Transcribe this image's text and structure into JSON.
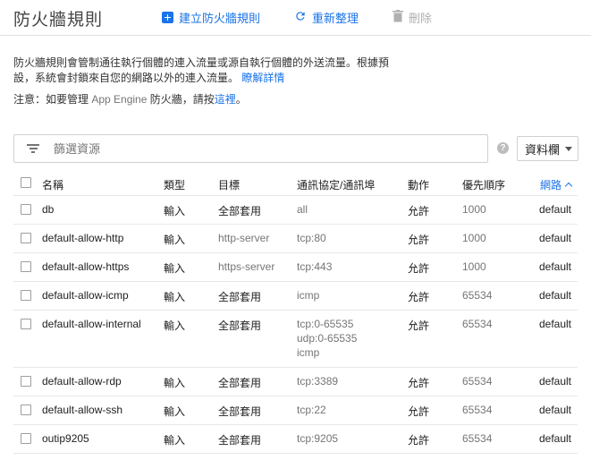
{
  "header": {
    "title": "防火牆規則",
    "create_label": "建立防火牆規則",
    "refresh_label": "重新整理",
    "delete_label": "刪除"
  },
  "description": {
    "line1": "防火牆規則會管制通往執行個體的連入流量或源自執行個體的外送流量。根據預",
    "line2": "設，系統會封鎖來自您的網路以外的連入流量。",
    "learn_more": "瞭解詳情"
  },
  "note": {
    "prefix": "注意：如要管理 ",
    "app_engine": "App Engine",
    "middle": " 防火牆，請按",
    "link": "這裡",
    "suffix": "。"
  },
  "filter": {
    "placeholder": "篩選資源"
  },
  "columns_button": "資料欄",
  "table": {
    "headers": {
      "name": "名稱",
      "type": "類型",
      "target": "目標",
      "protocol": "通訊協定/通訊埠",
      "action": "動作",
      "priority": "優先順序",
      "network": "網路"
    },
    "rows": [
      {
        "name": "db",
        "type": "輸入",
        "target": "全部套用",
        "protocols": [
          "all"
        ],
        "action": "允許",
        "priority": "1000",
        "network": "default"
      },
      {
        "name": "default-allow-http",
        "type": "輸入",
        "target": "http-server",
        "protocols": [
          "tcp:80"
        ],
        "action": "允許",
        "priority": "1000",
        "network": "default"
      },
      {
        "name": "default-allow-https",
        "type": "輸入",
        "target": "https-server",
        "protocols": [
          "tcp:443"
        ],
        "action": "允許",
        "priority": "1000",
        "network": "default"
      },
      {
        "name": "default-allow-icmp",
        "type": "輸入",
        "target": "全部套用",
        "protocols": [
          "icmp"
        ],
        "action": "允許",
        "priority": "65534",
        "network": "default"
      },
      {
        "name": "default-allow-internal",
        "type": "輸入",
        "target": "全部套用",
        "protocols": [
          "tcp:0-65535",
          "udp:0-65535",
          "icmp"
        ],
        "action": "允許",
        "priority": "65534",
        "network": "default"
      },
      {
        "name": "default-allow-rdp",
        "type": "輸入",
        "target": "全部套用",
        "protocols": [
          "tcp:3389"
        ],
        "action": "允許",
        "priority": "65534",
        "network": "default"
      },
      {
        "name": "default-allow-ssh",
        "type": "輸入",
        "target": "全部套用",
        "protocols": [
          "tcp:22"
        ],
        "action": "允許",
        "priority": "65534",
        "network": "default"
      },
      {
        "name": "outip9205",
        "type": "輸入",
        "target": "全部套用",
        "protocols": [
          "tcp:9205"
        ],
        "action": "允許",
        "priority": "65534",
        "network": "default"
      }
    ]
  }
}
